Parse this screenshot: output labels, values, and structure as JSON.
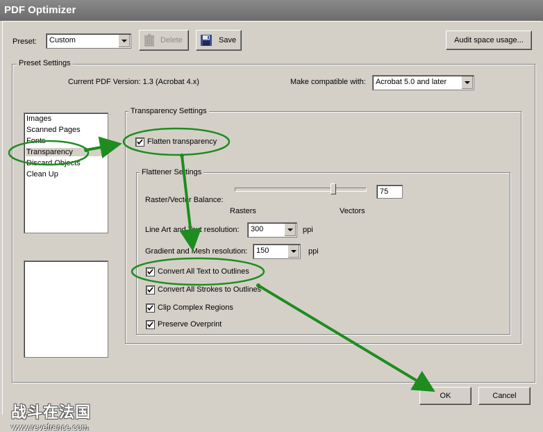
{
  "window": {
    "title": "PDF Optimizer"
  },
  "toolbar": {
    "preset_label": "Preset:",
    "preset_value": "Custom",
    "delete_label": "Delete",
    "save_label": "Save",
    "audit_label": "Audit space usage..."
  },
  "preset_settings": {
    "group_label": "Preset Settings",
    "current_version": "Current PDF Version: 1.3 (Acrobat 4.x)",
    "compat_label": "Make compatible with:",
    "compat_value": "Acrobat 5.0 and later"
  },
  "categories": {
    "items": [
      "Images",
      "Scanned Pages",
      "Fonts",
      "Transparency",
      "Discard Objects",
      "Clean Up"
    ],
    "selected_index": 3
  },
  "transparency": {
    "group_label": "Transparency Settings",
    "flatten_label": "Flatten transparency",
    "flatten_checked": true
  },
  "flattener": {
    "group_label": "Flattener Settings",
    "balance_label": "Raster/Vector Balance:",
    "balance_value": "75",
    "balance_level_percent": 75,
    "rasters_label": "Rasters",
    "vectors_label": "Vectors",
    "lineart_label": "Line Art and Text resolution:",
    "lineart_value": "300",
    "lineart_unit": "ppi",
    "gradient_label": "Gradient and Mesh resolution:",
    "gradient_value": "150",
    "gradient_unit": "ppi",
    "options": [
      {
        "label": "Convert All Text to Outlines",
        "checked": true
      },
      {
        "label": "Convert All Strokes to Outlines",
        "checked": true
      },
      {
        "label": "Clip Complex Regions",
        "checked": true
      },
      {
        "label": "Preserve Overprint",
        "checked": true
      }
    ]
  },
  "footer": {
    "ok_label": "OK",
    "cancel_label": "Cancel"
  },
  "watermark": {
    "chinese": "战斗在法国",
    "url": "www.revefrance.com"
  },
  "annotation_color": "#1e8c1e"
}
